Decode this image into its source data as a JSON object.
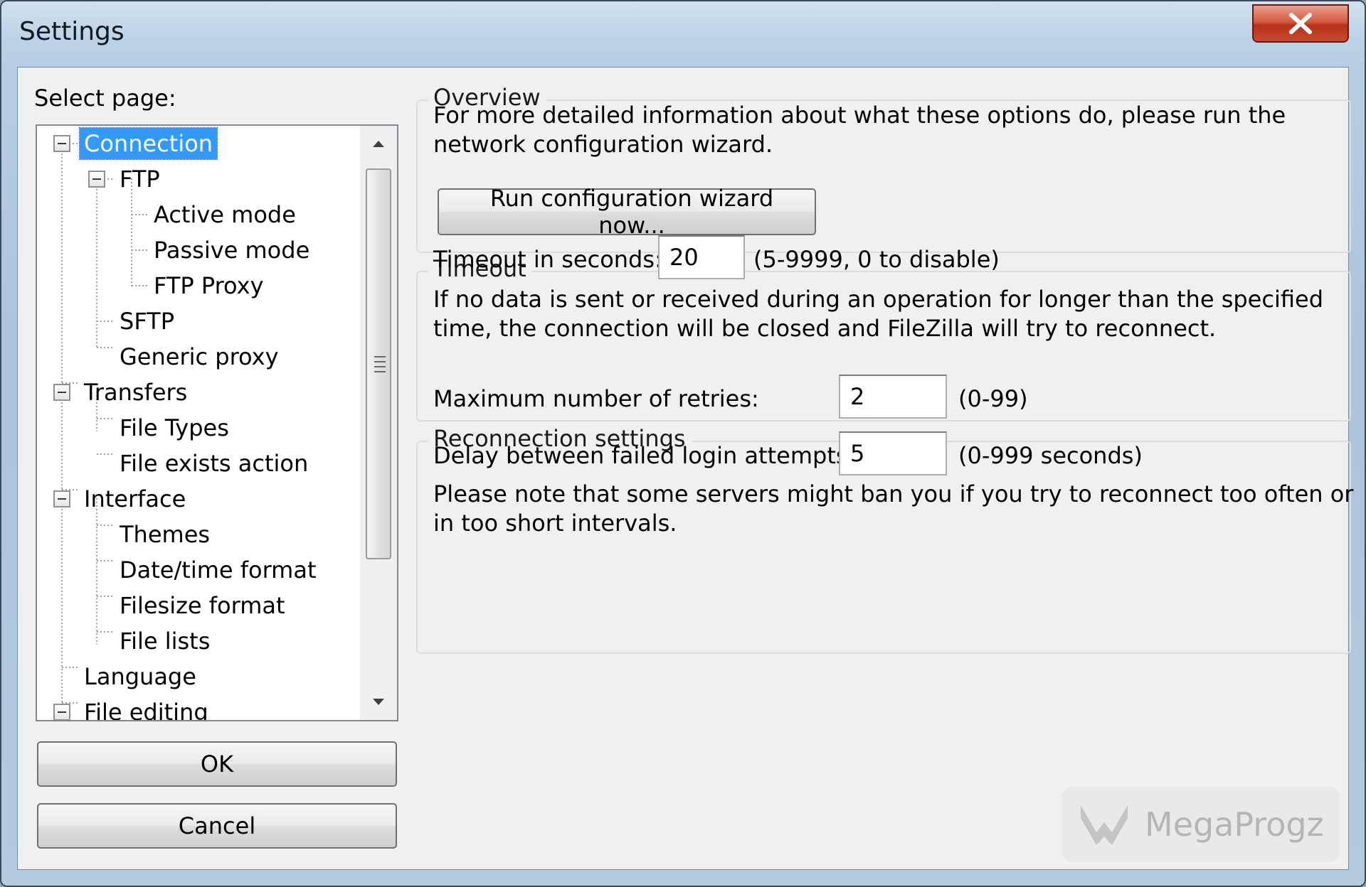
{
  "window": {
    "title": "Settings",
    "close_icon": "close-icon"
  },
  "sidebar": {
    "label": "Select page:",
    "tree": [
      {
        "label": "Connection",
        "level": 0,
        "expanded": true,
        "selected": true
      },
      {
        "label": "FTP",
        "level": 1,
        "expanded": true
      },
      {
        "label": "Active mode",
        "level": 2
      },
      {
        "label": "Passive mode",
        "level": 2
      },
      {
        "label": "FTP Proxy",
        "level": 2
      },
      {
        "label": "SFTP",
        "level": 1
      },
      {
        "label": "Generic proxy",
        "level": 1
      },
      {
        "label": "Transfers",
        "level": 0,
        "expanded": true
      },
      {
        "label": "File Types",
        "level": 1
      },
      {
        "label": "File exists action",
        "level": 1
      },
      {
        "label": "Interface",
        "level": 0,
        "expanded": true
      },
      {
        "label": "Themes",
        "level": 1
      },
      {
        "label": "Date/time format",
        "level": 1
      },
      {
        "label": "Filesize format",
        "level": 1
      },
      {
        "label": "File lists",
        "level": 1
      },
      {
        "label": "Language",
        "level": 0
      },
      {
        "label": "File editing",
        "level": 0,
        "expanded": true
      }
    ],
    "ok_label": "OK",
    "cancel_label": "Cancel"
  },
  "overview": {
    "legend": "Overview",
    "line1": "For more detailed information about what these options do, please run the",
    "line2": "network configuration wizard.",
    "wizard_button": "Run configuration wizard now..."
  },
  "timeout": {
    "legend": "Timeout",
    "label": "Timeout in seconds:",
    "value": "20",
    "range": "(5-9999, 0 to disable)",
    "note1": "If no data is sent or received during an operation for longer than the specified",
    "note2": "time, the connection will be closed and FileZilla will try to reconnect."
  },
  "reconnect": {
    "legend": "Reconnection settings",
    "retries_label": "Maximum number of retries:",
    "retries_value": "2",
    "retries_range": "(0-99)",
    "delay_label": "Delay between failed login attempts:",
    "delay_value": "5",
    "delay_range": "(0-999 seconds)",
    "note1": "Please note that some servers might ban you if you try to reconnect too often or",
    "note2": "in too short intervals."
  },
  "watermark": {
    "text": "MegaProgz"
  },
  "colors": {
    "selection": "#3399ff",
    "close_button": "#c84a30"
  }
}
